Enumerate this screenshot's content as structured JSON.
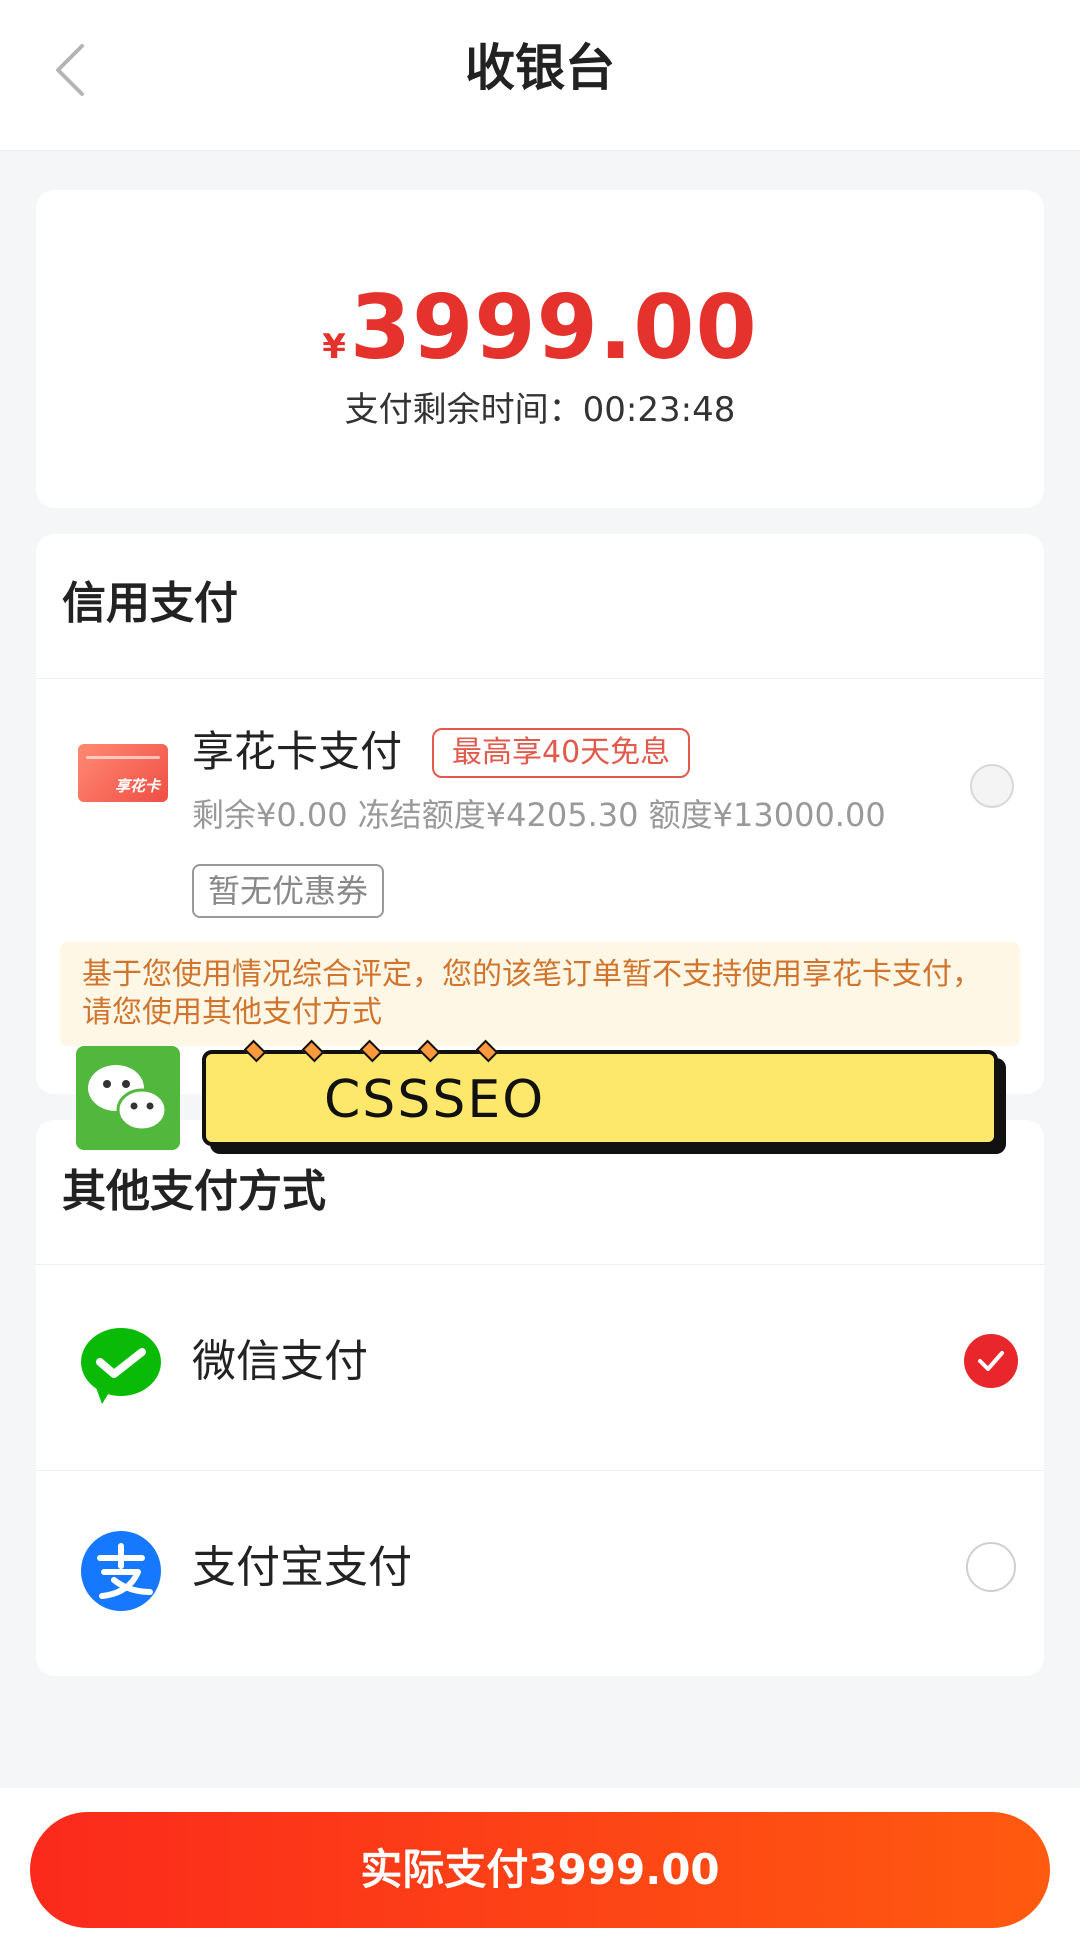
{
  "header": {
    "title": "收银台"
  },
  "amount": {
    "currency": "¥",
    "value": "3999.00",
    "countdown": "支付剩余时间：00:23:48"
  },
  "credit": {
    "title": "信用支付",
    "option": {
      "icon_text": "享花卡",
      "name": "享花卡支付",
      "promo": "最高享40天免息",
      "limits": "剩余¥0.00 冻结额度¥4205.30 额度¥13000.00",
      "coupon": "暂无优惠券",
      "notice": "基于您使用情况综合评定，您的该笔订单暂不支持使用享花卡支付，请您使用其他支付方式"
    }
  },
  "overlay": {
    "text": "CSSSEO"
  },
  "other": {
    "title": "其他支付方式",
    "options": [
      {
        "name": "微信支付",
        "selected": true,
        "icon": "wechat-pay-icon",
        "color": "#09bb07"
      },
      {
        "name": "支付宝支付",
        "selected": false,
        "icon": "alipay-icon",
        "color": "#1677ff"
      }
    ]
  },
  "footer": {
    "pay_button": "实际支付3999.00"
  },
  "colors": {
    "accent": "#e5322d",
    "button_start": "#fb2a1c",
    "button_end": "#ff5a10"
  }
}
